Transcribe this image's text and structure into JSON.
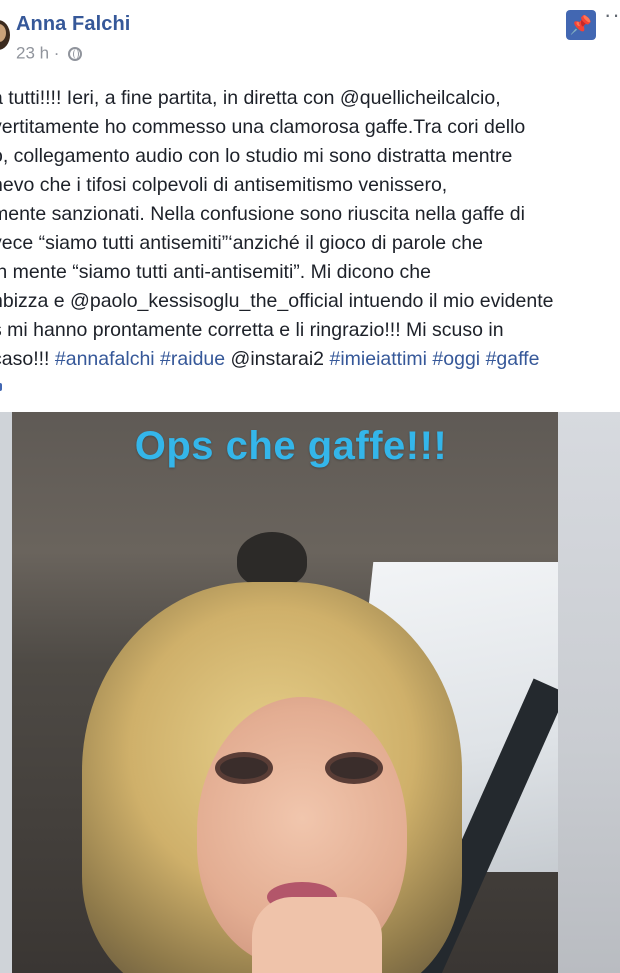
{
  "header": {
    "author": "Anna Falchi",
    "time": "23 h ·"
  },
  "post": {
    "lines": [
      "a tutti!!!! Ieri, a fine partita, in diretta con @quellicheilcalcio,",
      "vertitamente ho commesso una clamorosa gaffe.Tra cori dello",
      "o, collegamento audio con lo studio mi sono distratta mentre",
      "nevo che i tifosi colpevoli di antisemitismo venissero,",
      "mente sanzionati. Nella confusione sono riuscita nella gaffe di",
      "vece “siamo tutti antisemiti”‘anziché il gioco di parole che",
      "in mente “siamo tutti anti-antisemiti”. Mi dicono che",
      "nbizza e @paolo_kessisoglu_the_official intuendo il mio evidente",
      "s mi hanno prontamente corretta e li ringrazio!!! Mi scuso in"
    ],
    "last_line": {
      "prefix": "caso!!! ",
      "tag1": "#annafalchi",
      "tag2": "#raidue",
      "mention": "@instarai2",
      "tag3": "#imieiattimi",
      "tag4": "#oggi",
      "tag5": "#gaffe"
    }
  },
  "video": {
    "caption": "Ops che gaffe!!!"
  },
  "colors": {
    "link": "#365899",
    "pin_background": "#4267b2",
    "caption": "#34b6ea"
  },
  "icons": {
    "pin": "pin-icon",
    "privacy": "globe-icon",
    "more": "more-options-icon"
  }
}
